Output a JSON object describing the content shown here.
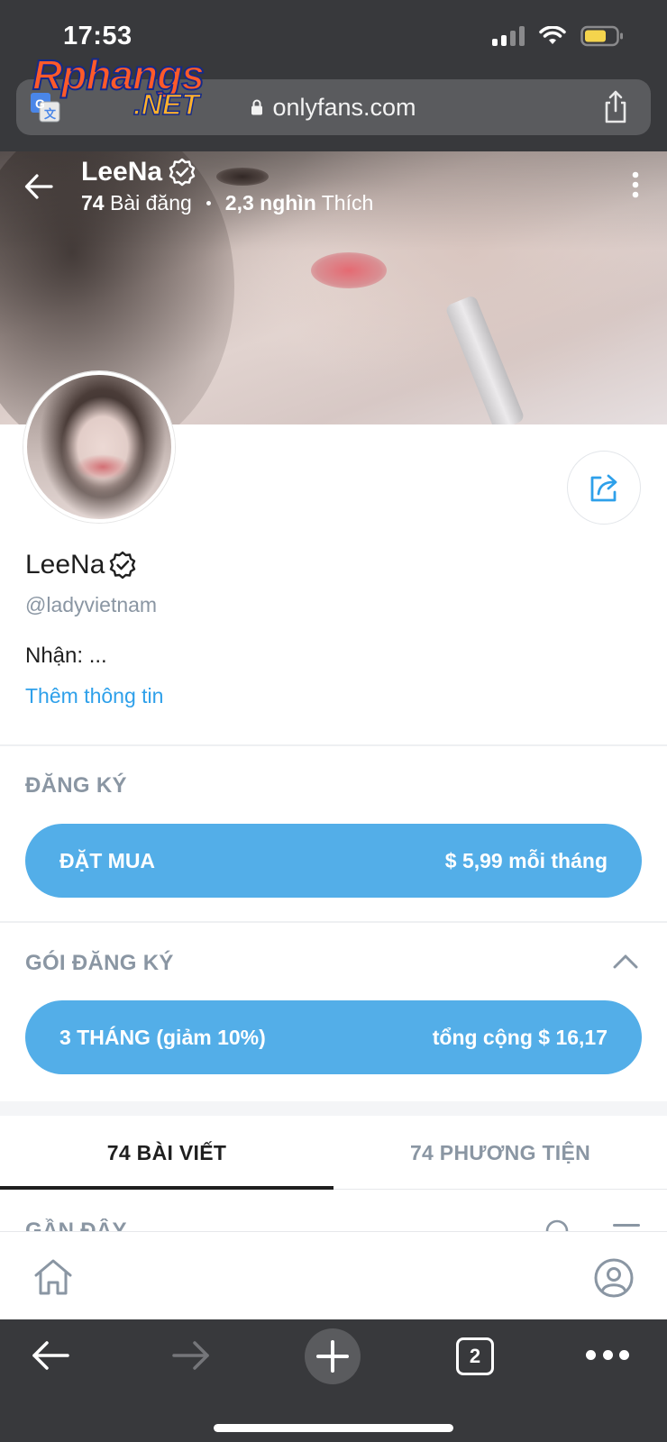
{
  "status_bar": {
    "time": "17:53"
  },
  "watermark": {
    "main": "Rphangs",
    "sub": ".NET"
  },
  "browser": {
    "url": "onlyfans.com",
    "tab_count": "2"
  },
  "header": {
    "name": "LeeNa",
    "posts_count": "74",
    "posts_label": "Bài đăng",
    "likes_count": "2,3 nghìn",
    "likes_label": "Thích"
  },
  "profile": {
    "name": "LeeNa",
    "handle": "@ladyvietnam",
    "bio": "Nhận: ...",
    "more_info": "Thêm thông tin"
  },
  "subscription": {
    "section_title": "ĐĂNG KÝ",
    "button_label": "ĐẶT MUA",
    "button_price": "$ 5,99 mỗi tháng"
  },
  "bundles": {
    "section_title": "GÓI ĐĂNG KÝ",
    "items": [
      {
        "label": "3 THÁNG (giảm 10%)",
        "price": "tổng cộng $ 16,17"
      }
    ]
  },
  "tabs": [
    {
      "label": "74 BÀI VIẾT",
      "active": true
    },
    {
      "label": "74 PHƯƠNG TIỆN",
      "active": false
    }
  ],
  "feed": {
    "label": "GẦN ĐÂY"
  },
  "colors": {
    "accent": "#53aee8",
    "link": "#2ea0ea",
    "muted": "#8a96a3",
    "chrome": "#38393c"
  },
  "icons": {
    "back": "arrow-left-icon",
    "verified": "verified-badge-icon",
    "more": "kebab-menu-icon",
    "share": "share-icon",
    "home": "home-icon",
    "profile": "user-circle-icon",
    "search": "search-icon",
    "sort": "sort-icon"
  }
}
